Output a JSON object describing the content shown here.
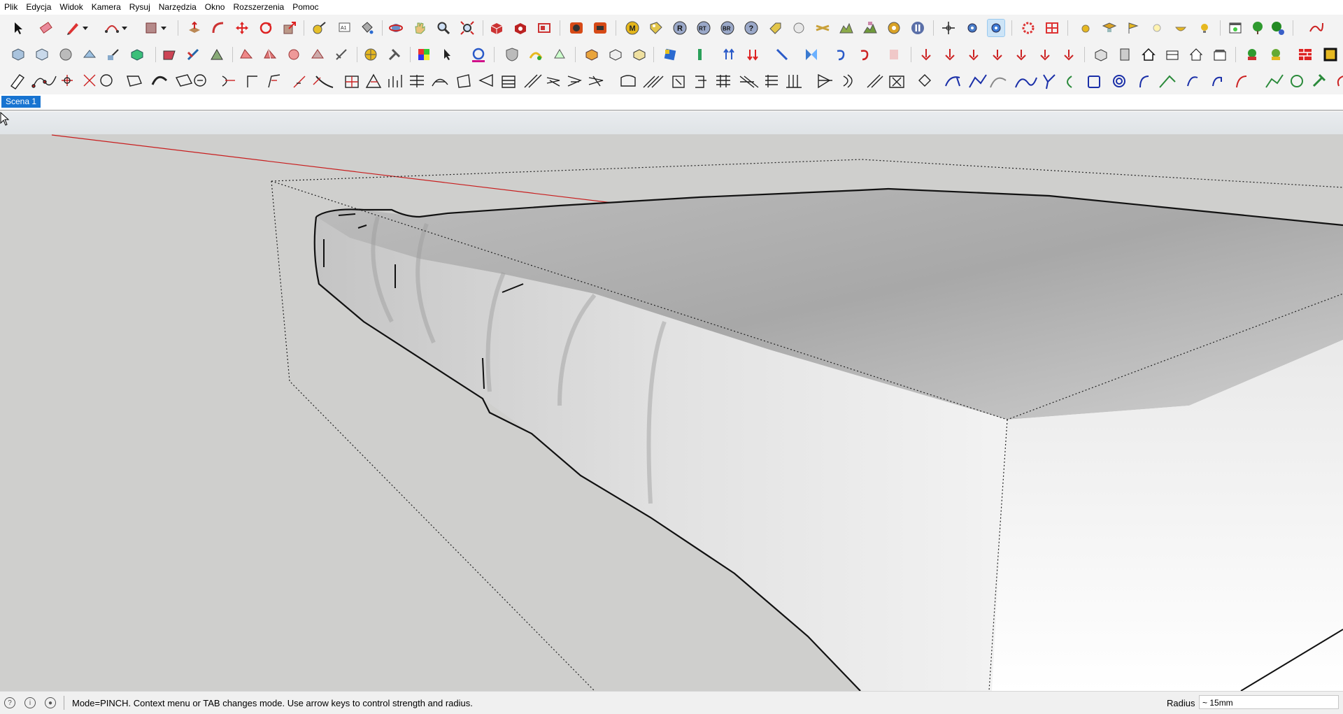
{
  "menu": [
    "Plik",
    "Edycja",
    "Widok",
    "Kamera",
    "Rysuj",
    "Narzędzia",
    "Okno",
    "Rozszerzenia",
    "Pomoc"
  ],
  "toolbar1_labels": {
    "text_tool": "A1",
    "mode_m": "M",
    "mode_r": "R",
    "mode_rt": "RT",
    "mode_br": "BR",
    "mode_help": "?"
  },
  "scene_tab": "Scena 1",
  "status": {
    "message": "Mode=PINCH.  Context menu or TAB changes mode.  Use arrow keys to control strength and radius.",
    "radius_label": "Radius",
    "radius_value": "~ 15mm"
  },
  "colors": {
    "accent": "#1874d1",
    "red_axis": "#c81e1e",
    "green_axis": "#2ea043",
    "viewport_bg": "#cfcfcd"
  }
}
